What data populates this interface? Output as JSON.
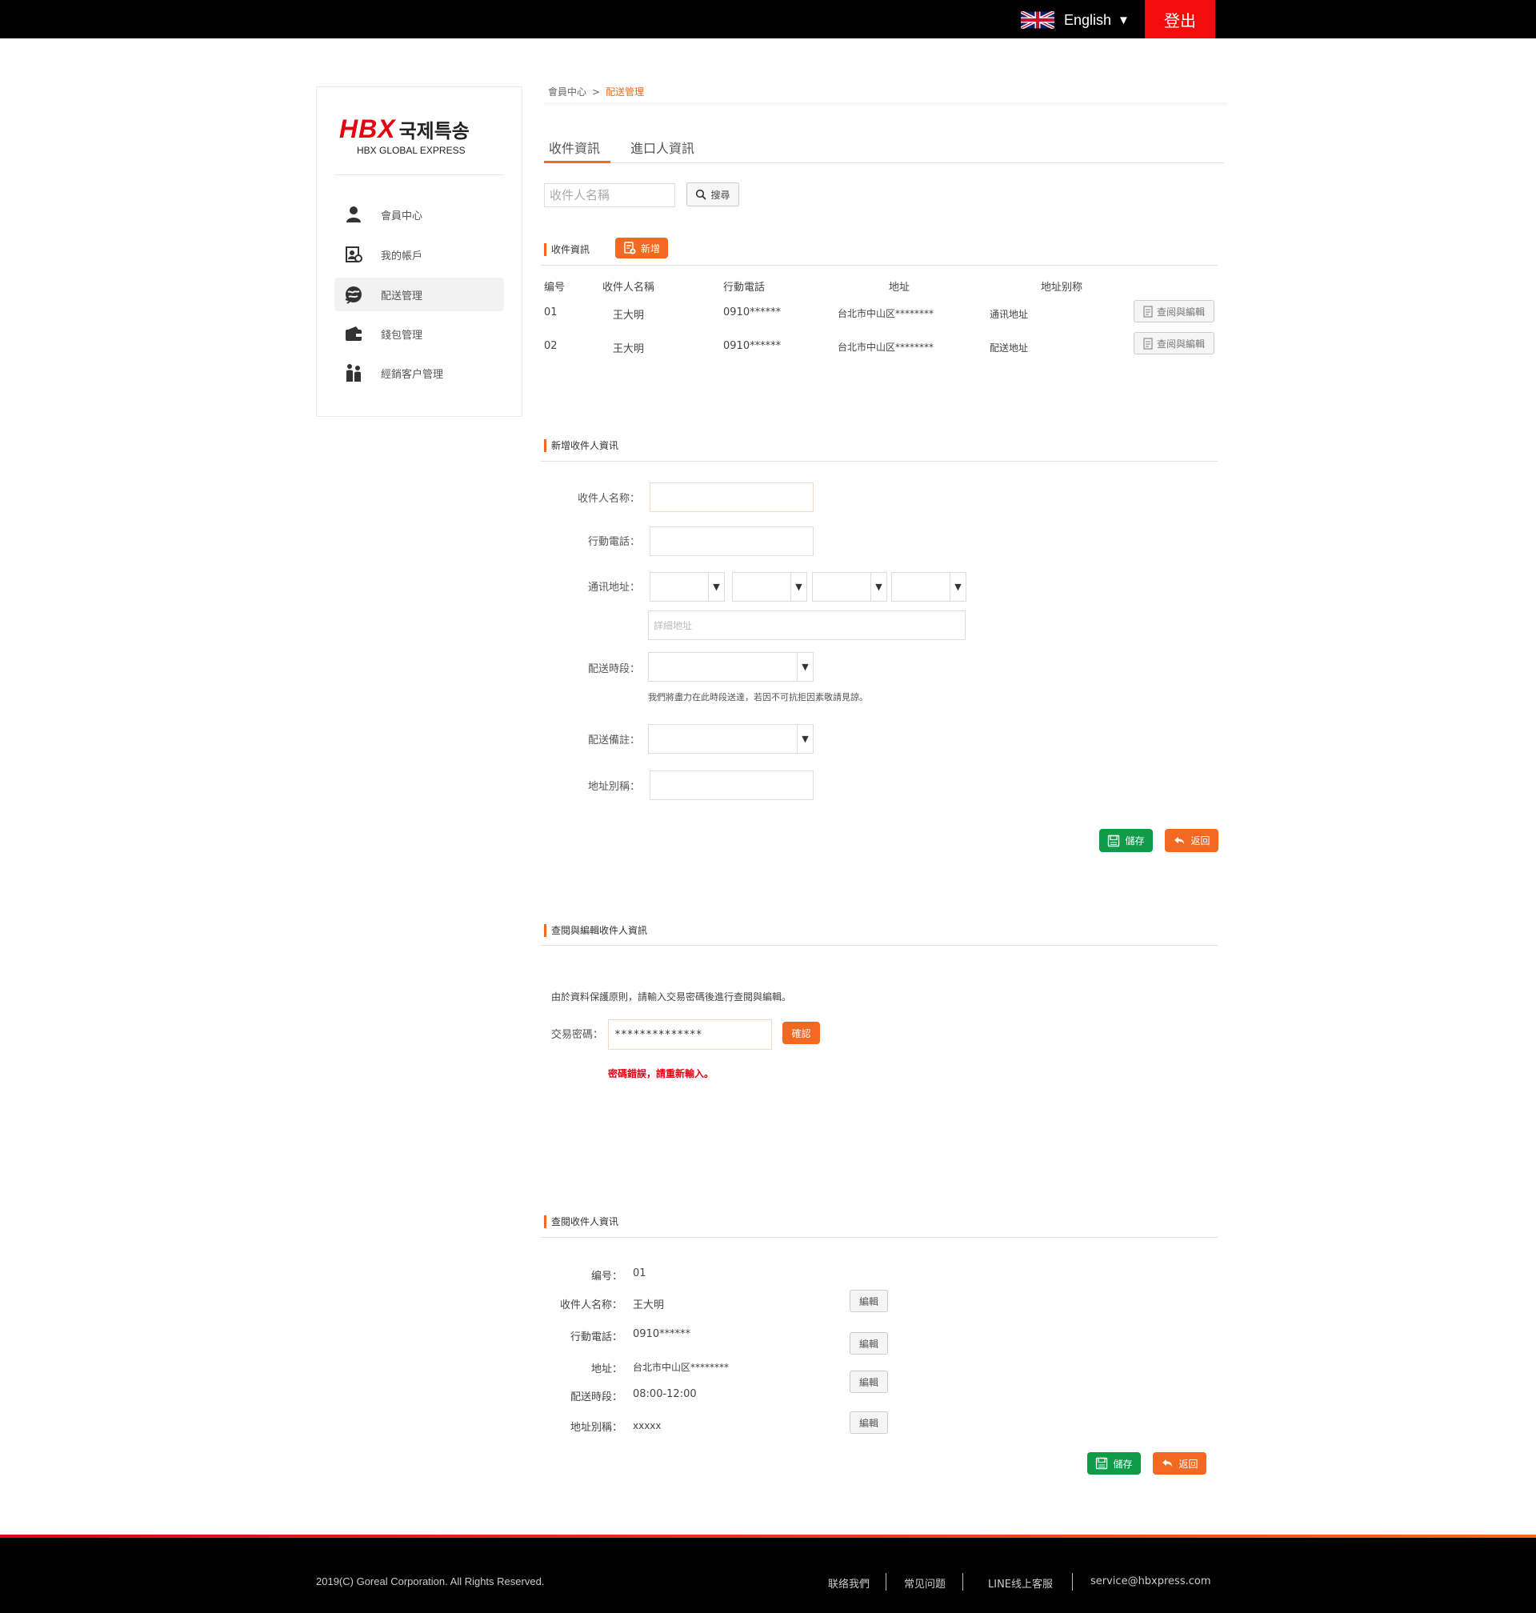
{
  "header": {
    "language": "English",
    "logout_label": "登出"
  },
  "logo": {
    "brand": "HBX",
    "korean": "국제특송",
    "subtitle": "HBX GLOBAL EXPRESS"
  },
  "sidebar": {
    "items": [
      {
        "label": "會員中心",
        "icon": "user-icon"
      },
      {
        "label": "我的帳戶",
        "icon": "account-icon"
      },
      {
        "label": "配送管理",
        "icon": "globe-delivery-icon",
        "active": true
      },
      {
        "label": "錢包管理",
        "icon": "wallet-icon"
      },
      {
        "label": "經銷客户管理",
        "icon": "people-icon"
      }
    ]
  },
  "breadcrumb": {
    "parent": "會員中心",
    "separator": ">",
    "current": "配送管理"
  },
  "tabs": {
    "recipient": "收件資訊",
    "importer": "進口人資訊"
  },
  "search": {
    "placeholder": "收件人名稱",
    "button": "搜尋"
  },
  "recipient_list": {
    "title": "收件資訊",
    "add_button": "新增",
    "columns": [
      "编号",
      "收件人名稱",
      "行動電話",
      "地址",
      "地址别称"
    ],
    "rows": [
      {
        "id": "01",
        "name": "王大明",
        "phone": "0910******",
        "address": "台北市中山区********",
        "alias": "通讯地址",
        "action": "查阅與編輯"
      },
      {
        "id": "02",
        "name": "王大明",
        "phone": "0910******",
        "address": "台北市中山区********",
        "alias": "配送地址",
        "action": "查阅與編輯"
      }
    ]
  },
  "new_recipient": {
    "title": "新增收件人資讯",
    "name_label": "收件人名称：",
    "phone_label": "行動電話：",
    "address_label": "通讯地址：",
    "address_detail_placeholder": "詳細地址",
    "time_label": "配送時段：",
    "time_hint": "我們將盡力在此時段送達，若因不可抗拒因素敬請見諒。",
    "note_label": "配送備註：",
    "alias_label": "地址別稱：",
    "save_button": "儲存",
    "back_button": "返回"
  },
  "verify": {
    "title": "查閱與編輯收件人資訊",
    "notice": "由於資料保護原則，請輸入交易密碼後進行查閱與編輯。",
    "password_label": "交易密碼：",
    "password_value": "**************",
    "confirm_button": "確認",
    "error": "密碼錯誤，請重新輸入。"
  },
  "detail": {
    "title": "查閱收件人資讯",
    "id_label": "编号：",
    "id_value": "01",
    "name_label": "收件人名称：",
    "name_value": "王大明",
    "phone_label": "行動電話：",
    "phone_value": "0910******",
    "address_label": "地址：",
    "address_value": "台北市中山区********",
    "time_label": "配送時段：",
    "time_value": "08:00-12:00",
    "alias_label": "地址別稱：",
    "alias_value": "xxxxx",
    "edit_button": "編輯",
    "save_button": "儲存",
    "back_button": "返回"
  },
  "footer": {
    "copyright": "2019(C) Goreal Corporation. All Rights Reserved.",
    "links": [
      "联络我們",
      "常见问题",
      "LINE线上客服",
      "service@hbxpress.com"
    ]
  },
  "colors": {
    "accent": "#f26a21",
    "logout": "#f40b0b",
    "save": "#0f9b48",
    "error": "#e60012"
  }
}
